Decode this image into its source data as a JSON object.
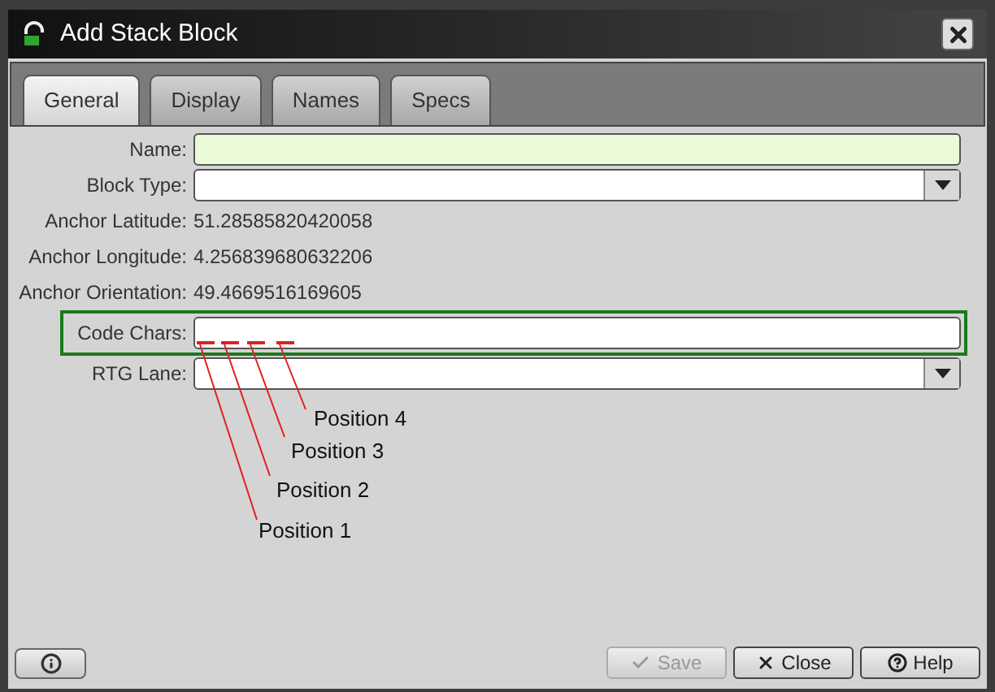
{
  "window": {
    "title": "Add Stack Block"
  },
  "tabs": [
    {
      "label": "General",
      "selected": true
    },
    {
      "label": "Display",
      "selected": false
    },
    {
      "label": "Names",
      "selected": false
    },
    {
      "label": "Specs",
      "selected": false
    }
  ],
  "fields": [
    {
      "kind": "input",
      "label": "Name:",
      "highlighted": true
    },
    {
      "kind": "select",
      "label": "Block Type:"
    },
    {
      "kind": "readonly",
      "label": "Anchor Latitude:",
      "value": "51.28585820420058"
    },
    {
      "kind": "readonly",
      "label": "Anchor Longitude:",
      "value": "4.256839680632206"
    },
    {
      "kind": "readonly",
      "label": "Anchor Orientation:",
      "value": "49.4669516169605"
    },
    {
      "kind": "input",
      "label": "Code Chars:",
      "highlighted": false,
      "outlined": true
    },
    {
      "kind": "select",
      "label": "RTG Lane:"
    }
  ],
  "annotations": [
    "Position 4",
    "Position 3",
    "Position 2",
    "Position 1"
  ],
  "buttons": [
    {
      "kind": "save",
      "label": "Save",
      "disabled": true
    },
    {
      "kind": "close",
      "label": "Close",
      "disabled": false
    },
    {
      "kind": "help",
      "label": "Help",
      "disabled": false
    }
  ]
}
